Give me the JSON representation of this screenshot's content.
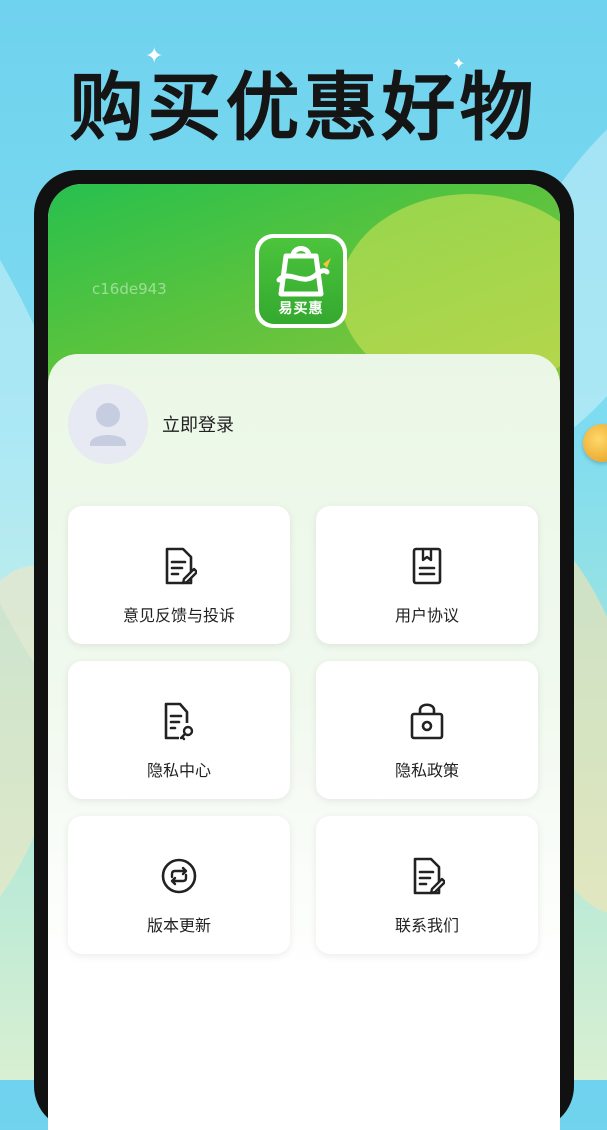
{
  "promo": {
    "headline": "购买优惠好物"
  },
  "app": {
    "device_id": "c16de943",
    "logo_text": "易买惠",
    "brand_color": "#34b93a"
  },
  "account": {
    "login_label": "立即登录"
  },
  "menu": [
    {
      "label": "意见反馈与投诉",
      "icon": "feedback-document-icon"
    },
    {
      "label": "用户协议",
      "icon": "agreement-book-icon"
    },
    {
      "label": "隐私中心",
      "icon": "privacy-key-document-icon"
    },
    {
      "label": "隐私政策",
      "icon": "privacy-lock-bag-icon"
    },
    {
      "label": "版本更新",
      "icon": "refresh-cycle-icon"
    },
    {
      "label": "联系我们",
      "icon": "contact-document-icon"
    }
  ]
}
